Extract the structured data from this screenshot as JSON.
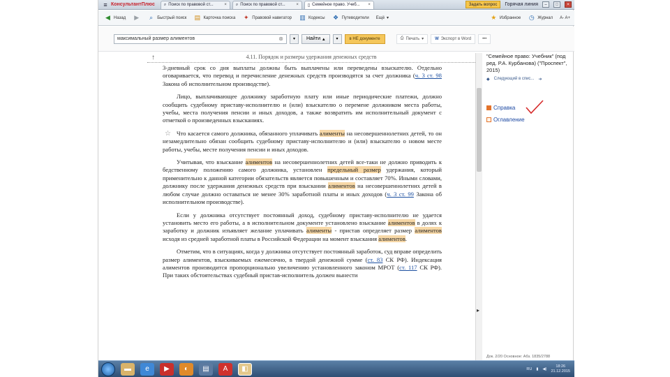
{
  "browser": {
    "brand": "КонсультантПлюс",
    "tabs": [
      {
        "label": "Поиск по правовой ст...",
        "active": false
      },
      {
        "label": "Поиск по правовой ст...",
        "active": false
      },
      {
        "label": "Семейное право. Учеб...",
        "active": true
      }
    ],
    "ask_label": "Задать вопрос",
    "right_label": "Горячая линия"
  },
  "toolbar": {
    "back": "Назад",
    "quick_search": "Быстрый поиск",
    "cards": "Карточка поиска",
    "navigator": "Правовой навигатор",
    "codes": "Кодексы",
    "guides": "Путеводители",
    "more": "Ещё",
    "favorites": "Избранное",
    "history": "Журнал",
    "font_size": "A- A+"
  },
  "search": {
    "value": "максимальный размер алиментов",
    "find_label": "Найти",
    "in_document_label": "в НЕ документе",
    "print_label": "Печать",
    "export_label": "Экспорт в Word",
    "more_label": "•••"
  },
  "document": {
    "heading": "4.11. Порядок и размеры удержания денежных средств",
    "p0_a": "3-дневный срок со дня выплаты должны быть выплачены или переведены взыскателю. Отдельно оговаривается, что перевод и перечисление денежных средств производятся за счет должника (",
    "p0_link": "ч. 3 ст. 98",
    "p0_b": " Закона об исполнительном производстве).",
    "p1": "Лицо, выплачивающее должнику заработную плату или иные периодические платежи, должно сообщить судебному приставу-исполнителю и (или) взыскателю о перемене должником места работы, учебы, места получения пенсии и иных доходов, а также возвратить им исполнительный документ с отметкой о произведенных взысканиях.",
    "p2_a": "Что касается самого должника, обязанного уплачивать ",
    "p2_hl": "алименты",
    "p2_b": " на несовершеннолетних детей, то он незамедлительно обязан сообщить судебному приставу-исполнителю и (или) взыскателю о новом месте работы, учебы, месте получения пенсии и иных доходов.",
    "p3_a": "Учитывая, что взыскание ",
    "p3_hl1": "алиментов",
    "p3_b": " на несовершеннолетних детей все-таки не должно приводить к бедственному положению самого должника, установлен ",
    "p3_hl2": "предельный",
    "p3_c": " ",
    "p3_hl3": "размер",
    "p3_d": " удержания, который применительно к данной категории обязательств является повышенным и составляет 70%. Иными словами, должнику после удержания денежных средств при взыскании ",
    "p3_hl4": "алиментов",
    "p3_e": " на несовершеннолетних детей в любом случае должно оставаться не менее 30% заработной платы и иных доходов (",
    "p3_link": "ч. 3 ст. 99",
    "p3_f": " Закона об исполнительном производстве).",
    "p4_a": "Если у должника отсутствует постоянный доход, судебному приставу-исполнителю не удается установить место его работы, а в исполнительном документе установлено взыскание ",
    "p4_hl1": "алиментов",
    "p4_b": " в долях к заработку и должник изъявляет желание уплачивать ",
    "p4_hl2": "алименты",
    "p4_c": " - пристав определяет размер ",
    "p4_hl3": "алиментов",
    "p4_d": " исходя из средней заработной платы в Российской Федерации на момент взыскания ",
    "p4_hl4": "алиментов",
    "p4_e": ".",
    "p5_a": "Отметим, что в ситуациях, когда у должника отсутствует постоянный заработок, суд вправе определить размер алиментов, взыскиваемых ежемесячно, в твердой денежной сумме (",
    "p5_link1": "ст. 83",
    "p5_b": " СК РФ). Индексация алиментов производится пропорционально увеличению установленного законом МРОТ (",
    "p5_link2": "ст. 117",
    "p5_c": " СК РФ). При таких обстоятельствах судебный пристав-исполнитель должен вынести"
  },
  "side": {
    "source": "\"Семейное право: Учебник\" (под ред. Р.А. Курбанова) (\"Проспект\", 2015)",
    "next_label": "Следующий в спис...",
    "help_label": "Справка",
    "toc_label": "Оглавление",
    "doc_info": "Док. 2/20 Основное: Абз. 1835/2788"
  },
  "taskbar": {
    "lang": "RU",
    "time": "18:26",
    "date": "21.12.2015"
  },
  "colors": {
    "highlight": "#f7d8a7",
    "link": "#1c4fa0",
    "check": "#d62a2a"
  }
}
